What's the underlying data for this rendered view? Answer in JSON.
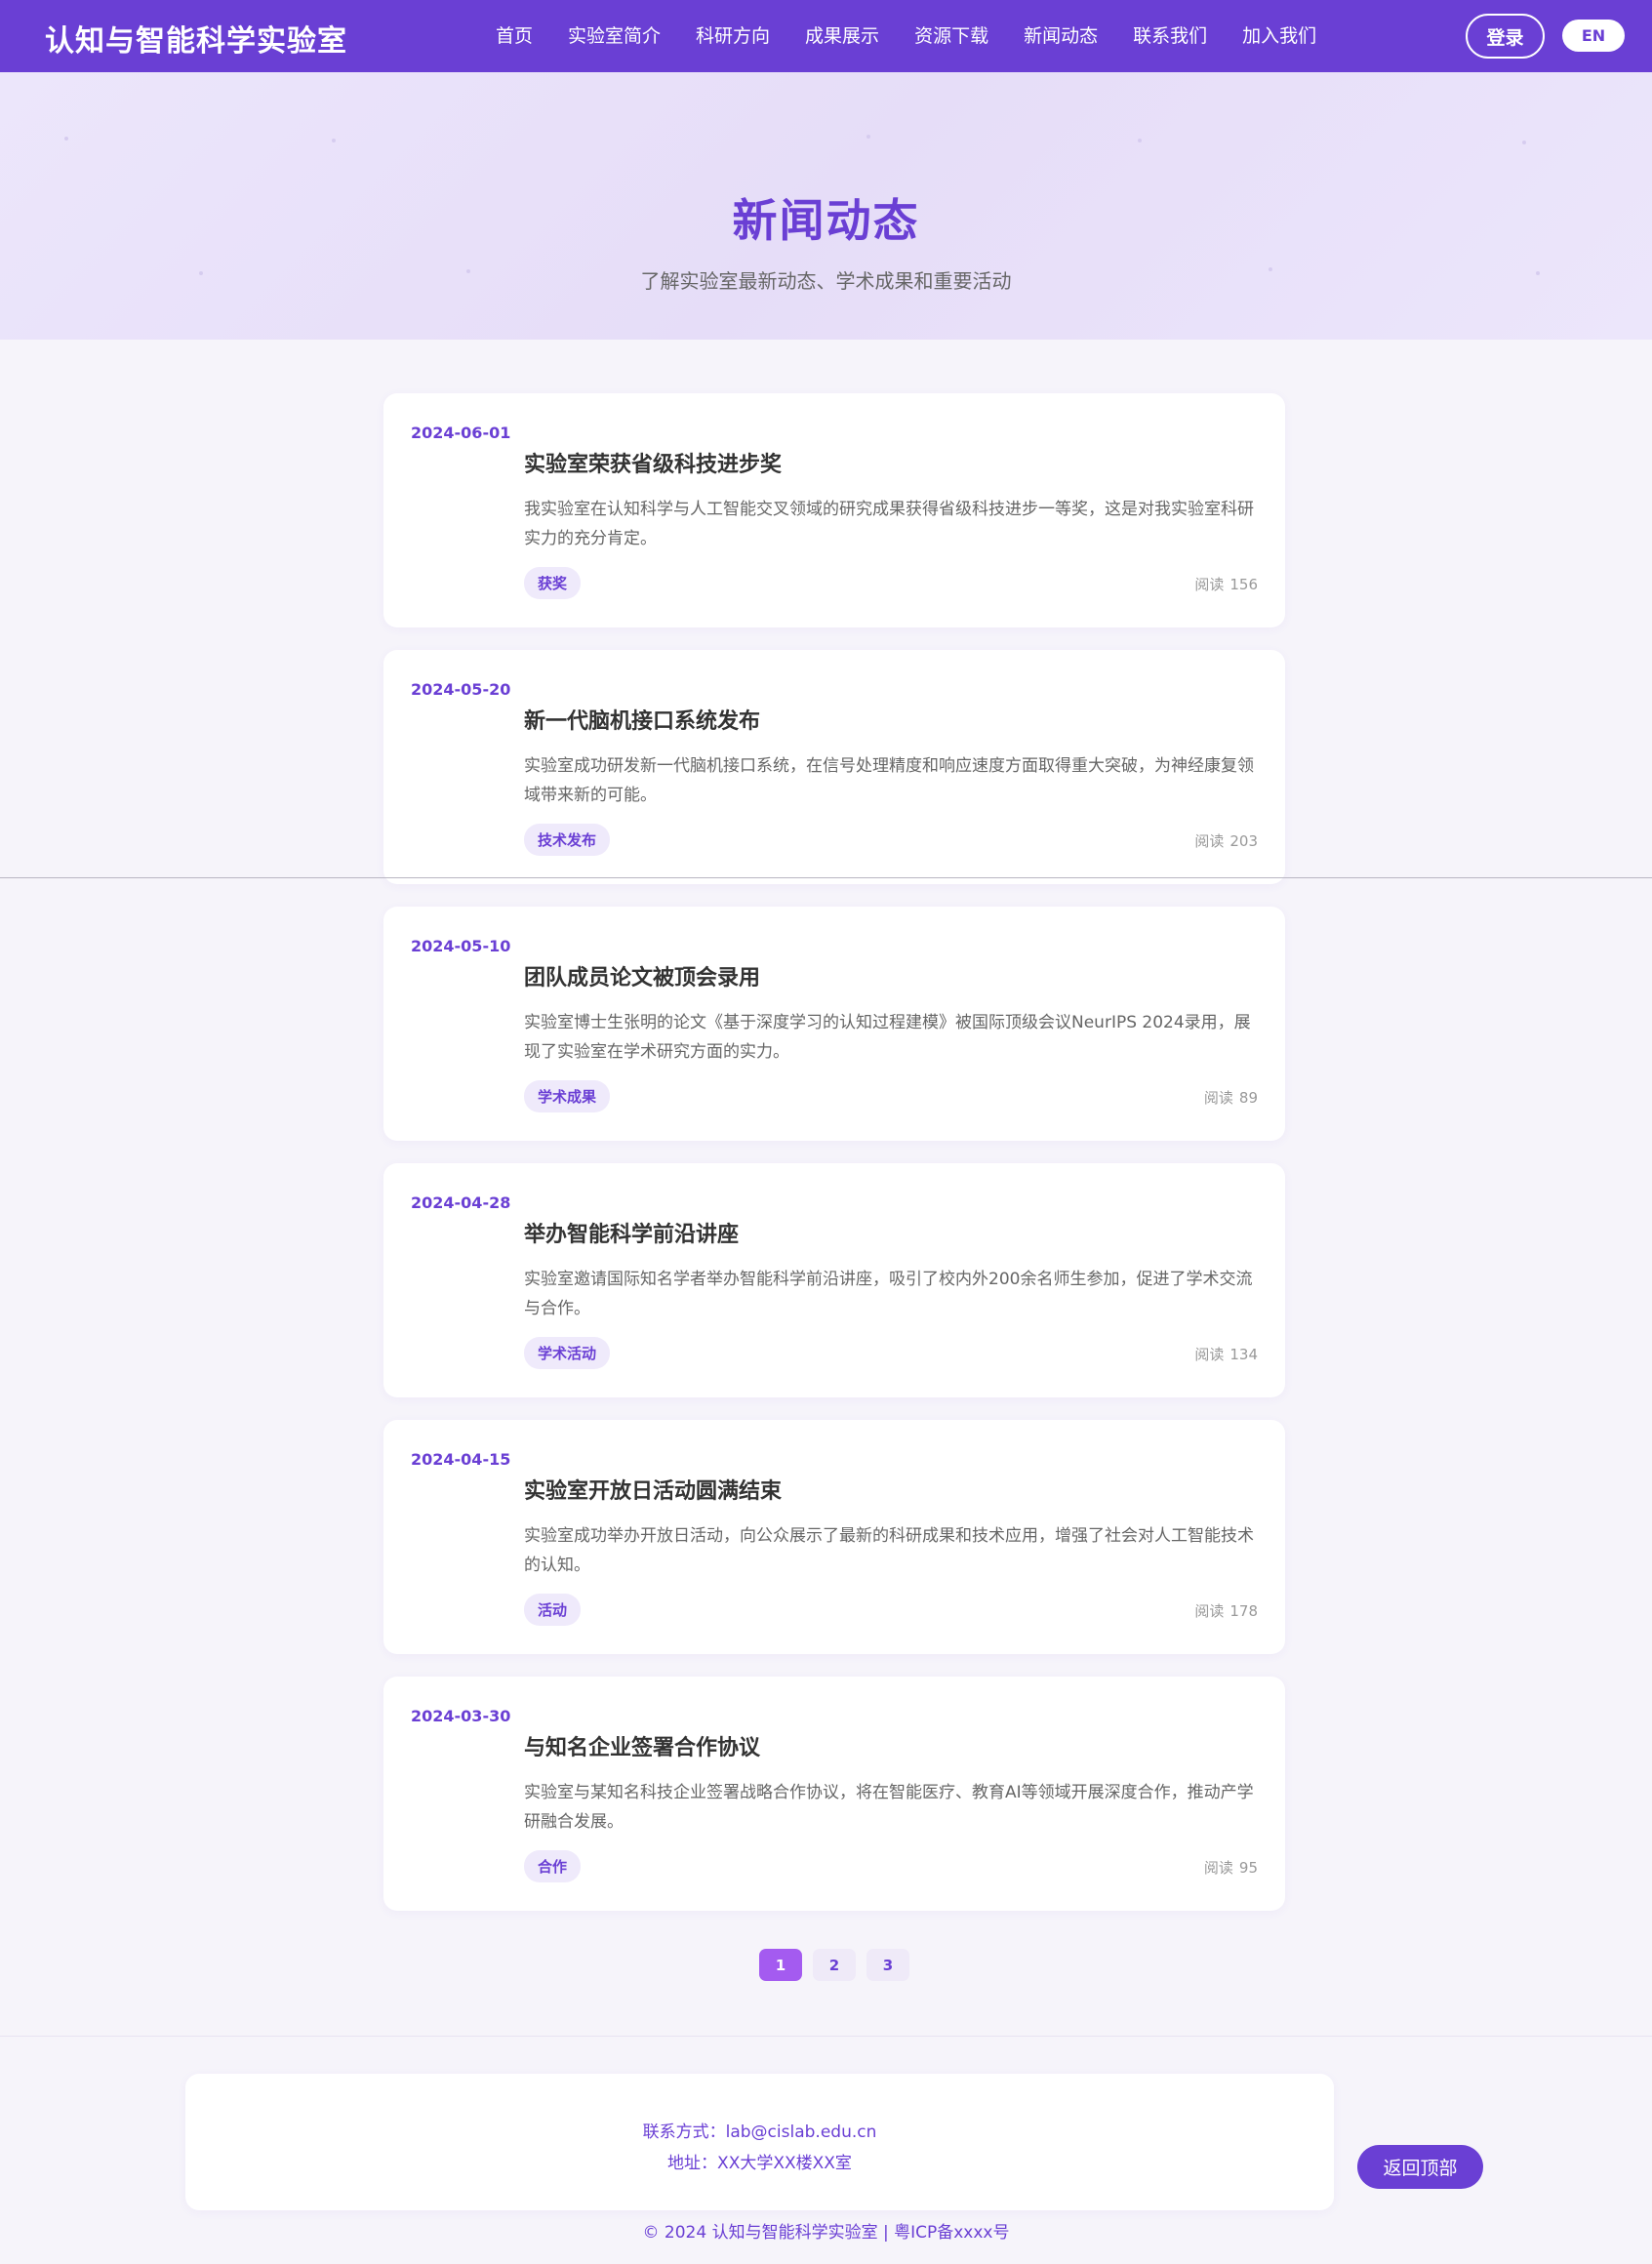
{
  "header": {
    "logo": "认知与智能科学实验室",
    "nav": [
      "首页",
      "实验室简介",
      "科研方向",
      "成果展示",
      "资源下载",
      "新闻动态",
      "联系我们",
      "加入我们"
    ],
    "login_label": "登录",
    "lang_label": "EN"
  },
  "hero": {
    "title": "新闻动态",
    "subtitle": "了解实验室最新动态、学术成果和重要活动"
  },
  "news": [
    {
      "date": "2024-06-01",
      "title": "实验室荣获省级科技进步奖",
      "summary": "我实验室在认知科学与人工智能交叉领域的研究成果获得省级科技进步一等奖，这是对我实验室科研实力的充分肯定。",
      "tag": "获奖",
      "reads_label": "阅读",
      "reads": "156"
    },
    {
      "date": "2024-05-20",
      "title": "新一代脑机接口系统发布",
      "summary": "实验室成功研发新一代脑机接口系统，在信号处理精度和响应速度方面取得重大突破，为神经康复领域带来新的可能。",
      "tag": "技术发布",
      "reads_label": "阅读",
      "reads": "203"
    },
    {
      "date": "2024-05-10",
      "title": "团队成员论文被顶会录用",
      "summary": "实验室博士生张明的论文《基于深度学习的认知过程建模》被国际顶级会议NeurIPS 2024录用，展现了实验室在学术研究方面的实力。",
      "tag": "学术成果",
      "reads_label": "阅读",
      "reads": "89"
    },
    {
      "date": "2024-04-28",
      "title": "举办智能科学前沿讲座",
      "summary": "实验室邀请国际知名学者举办智能科学前沿讲座，吸引了校内外200余名师生参加，促进了学术交流与合作。",
      "tag": "学术活动",
      "reads_label": "阅读",
      "reads": "134"
    },
    {
      "date": "2024-04-15",
      "title": "实验室开放日活动圆满结束",
      "summary": "实验室成功举办开放日活动，向公众展示了最新的科研成果和技术应用，增强了社会对人工智能技术的认知。",
      "tag": "活动",
      "reads_label": "阅读",
      "reads": "178"
    },
    {
      "date": "2024-03-30",
      "title": "与知名企业签署合作协议",
      "summary": "实验室与某知名科技企业签署战略合作协议，将在智能医疗、教育AI等领域开展深度合作，推动产学研融合发展。",
      "tag": "合作",
      "reads_label": "阅读",
      "reads": "95"
    }
  ],
  "pagination": {
    "pages": [
      "1",
      "2",
      "3"
    ],
    "current": "1"
  },
  "footer": {
    "contact": "联系方式：lab@cislab.edu.cn",
    "address": "地址：XX大学XX楼XX室",
    "back_to_top": "返回顶部",
    "copyright": "© 2024 认知与智能科学实验室 | 粤ICP备xxxx号"
  },
  "colors": {
    "primary": "#6a3fd4",
    "page_active": "#a45bf0",
    "tag_bg": "#efeafb",
    "background": "#f6f4fa"
  }
}
